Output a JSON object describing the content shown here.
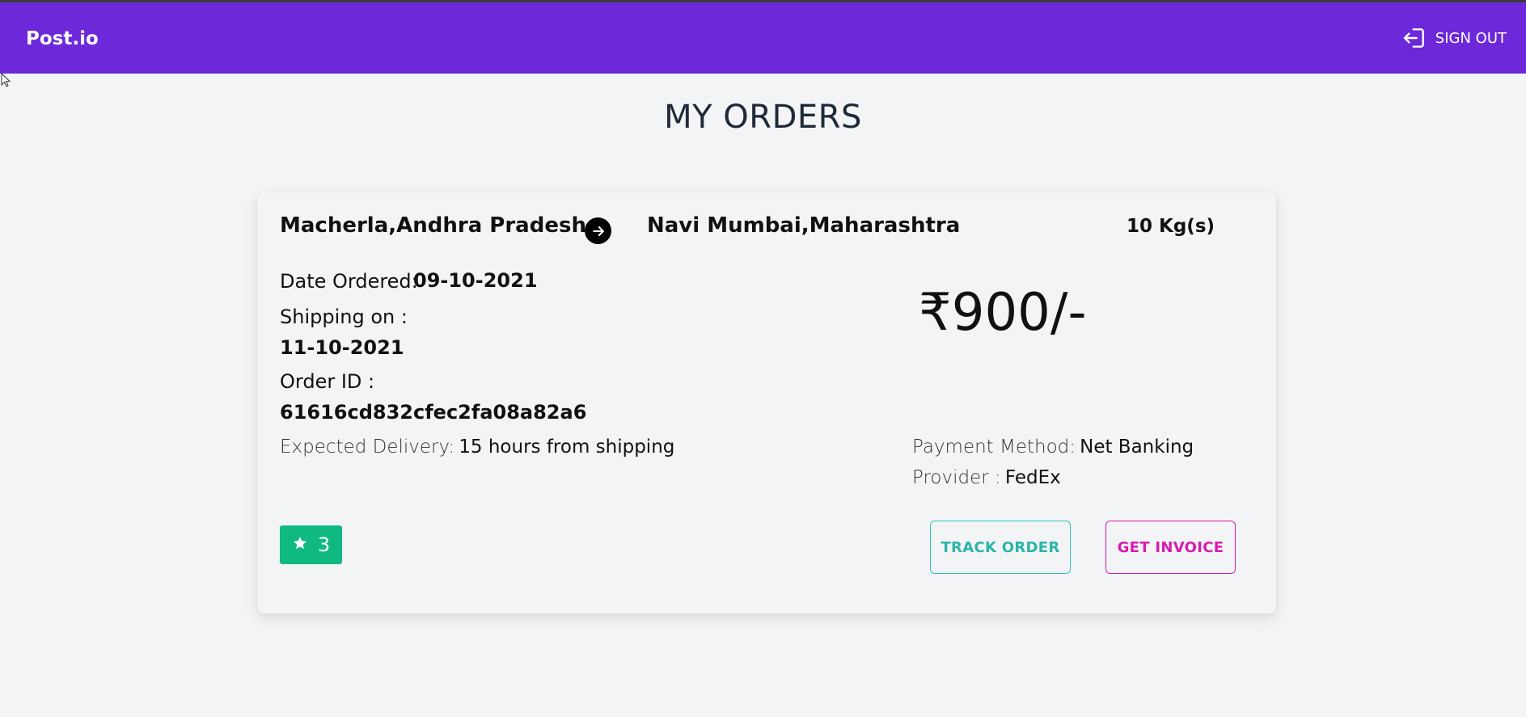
{
  "header": {
    "brand": "Post.io",
    "signout_label": "SIGN OUT",
    "signout_icon": "sign-out-icon",
    "color": "#6d28d9"
  },
  "page": {
    "title": "MY ORDERS"
  },
  "order": {
    "from": "Macherla,Andhra Pradesh",
    "to": "Navi Mumbai,Maharashtra",
    "weight": "10 Kg(s)",
    "date_ordered_label": "Date Ordered:",
    "date_ordered": "09-10-2021",
    "shipping_label": "Shipping on :",
    "shipping_date": "11-10-2021",
    "order_id_label": "Order ID :",
    "order_id": "61616cd832cfec2fa08a82a6",
    "expected_label": "Expected Delivery:",
    "expected_value": "15 hours from shipping",
    "price": "₹900/-",
    "payment_label": "Payment Method:",
    "payment_value": "Net Banking",
    "provider_label": "Provider :",
    "provider_value": "FedEx",
    "rating": "3",
    "rating_color": "#10b981",
    "track_label": "TRACK ORDER",
    "invoice_label": "GET INVOICE"
  }
}
